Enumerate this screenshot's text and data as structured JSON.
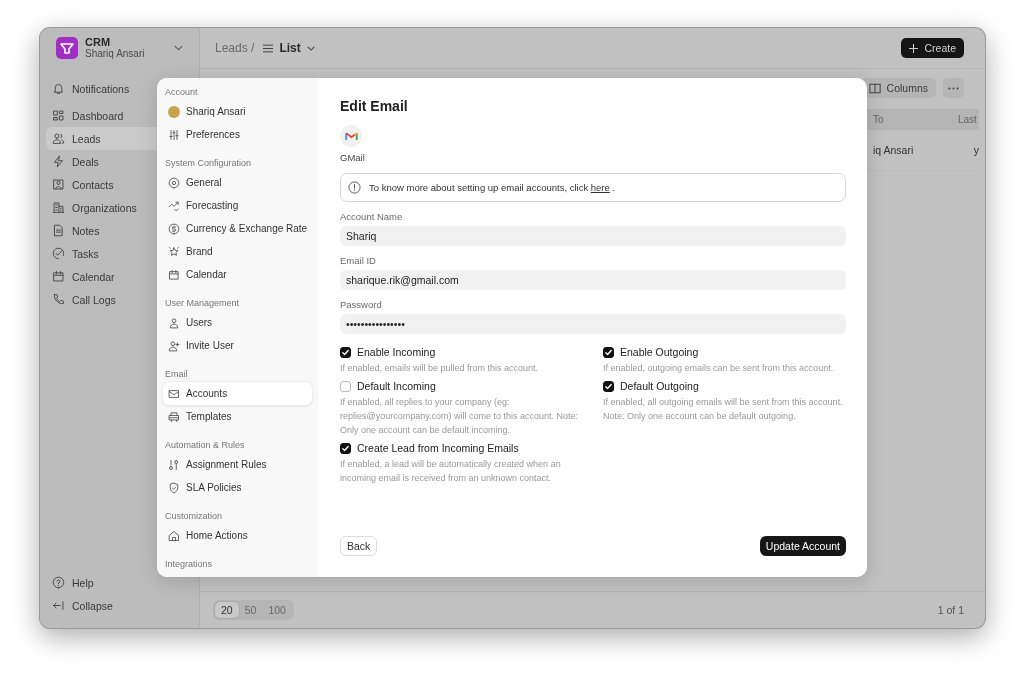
{
  "sidebar": {
    "brand": {
      "name": "CRM",
      "user": "Shariq Ansari"
    },
    "items": [
      {
        "label": "Notifications",
        "selected": false
      },
      {
        "label": "Dashboard",
        "selected": false
      },
      {
        "label": "Leads",
        "selected": true
      },
      {
        "label": "Deals",
        "selected": false
      },
      {
        "label": "Contacts",
        "selected": false
      },
      {
        "label": "Organizations",
        "selected": false
      },
      {
        "label": "Notes",
        "selected": false
      },
      {
        "label": "Tasks",
        "selected": false
      },
      {
        "label": "Calendar",
        "selected": false
      },
      {
        "label": "Call Logs",
        "selected": false
      }
    ],
    "footer_items": [
      "Help",
      "Collapse"
    ]
  },
  "main": {
    "breadcrumb": {
      "parent": "Leads /",
      "view": "List"
    },
    "create_button": "Create",
    "columns_button": "Columns",
    "table": {
      "columns": [
        "To",
        "Last"
      ],
      "rows": [
        [
          "iq Ansari",
          "y"
        ]
      ]
    },
    "pagination": {
      "page_sizes": [
        {
          "label": "20",
          "selected": true
        },
        {
          "label": "50",
          "selected": false
        },
        {
          "label": "100",
          "selected": false
        }
      ],
      "page_info": "1 of 1"
    }
  },
  "dialog": {
    "nav": [
      {
        "title": "Account",
        "items": [
          {
            "label": "Shariq Ansari",
            "selected": false
          },
          {
            "label": "Preferences",
            "selected": false
          }
        ]
      },
      {
        "title": "System Configuration",
        "items": [
          {
            "label": "General",
            "selected": false
          },
          {
            "label": "Forecasting",
            "selected": false
          },
          {
            "label": "Currency & Exchange Rate",
            "selected": false
          },
          {
            "label": "Brand",
            "selected": false
          },
          {
            "label": "Calendar",
            "selected": false
          }
        ]
      },
      {
        "title": "User Management",
        "items": [
          {
            "label": "Users",
            "selected": false
          },
          {
            "label": "Invite User",
            "selected": false
          }
        ]
      },
      {
        "title": "Email",
        "items": [
          {
            "label": "Accounts",
            "selected": true
          },
          {
            "label": "Templates",
            "selected": false
          }
        ]
      },
      {
        "title": "Automation & Rules",
        "items": [
          {
            "label": "Assignment Rules",
            "selected": false
          },
          {
            "label": "SLA Policies",
            "selected": false
          }
        ]
      },
      {
        "title": "Customization",
        "items": [
          {
            "label": "Home Actions",
            "selected": false
          }
        ]
      },
      {
        "title": "Integrations"
      }
    ],
    "title": "Edit Email",
    "provider": "GMail",
    "info": {
      "text": "To know more about setting up email accounts, click",
      "link": "here",
      "after": "."
    },
    "fields": [
      {
        "label": "Account Name",
        "value": "Shariq"
      },
      {
        "label": "Email ID",
        "value": "sharique.rik@gmail.com"
      },
      {
        "label": "Password",
        "value": "••••••••••••••••"
      }
    ],
    "options": [
      {
        "label": "Enable Incoming",
        "description": "If enabled, emails will be pulled from this account.",
        "checked": true
      },
      {
        "label": "Enable Outgoing",
        "description": "If enabled, outgoing emails can be sent from this account.",
        "checked": true
      },
      {
        "label": "Default Incoming",
        "description": "If enabled, all replies to your company (eg: replies@yourcompany.com) will come to this account. Note: Only one account can be default incoming.",
        "checked": false
      },
      {
        "label": "Default Outgoing",
        "description": "If enabled, all outgoing emails will be sent from this account. Note: Only one account can be default outgoing.",
        "checked": true
      },
      {
        "label": "Create Lead from Incoming Emails",
        "description": "If enabled, a lead will be automatically created when an incoming email is received from an unknown contact.",
        "checked": true
      }
    ],
    "back_button": "Back",
    "submit_button": "Update Account"
  }
}
